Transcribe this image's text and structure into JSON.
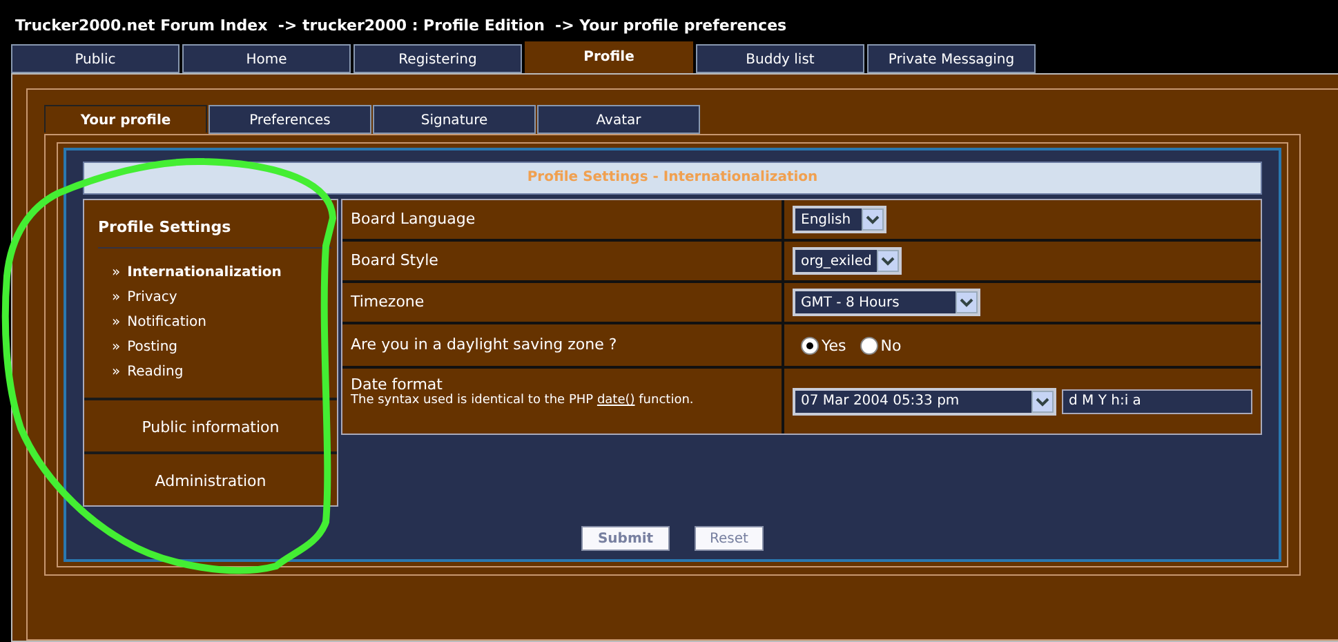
{
  "breadcrumb": "Trucker2000.net Forum Index  -> trucker2000 : Profile Edition  -> Your profile preferences",
  "top_tabs": [
    {
      "label": "Public",
      "selected": false
    },
    {
      "label": "Home",
      "selected": false
    },
    {
      "label": "Registering",
      "selected": false
    },
    {
      "label": "Profile",
      "selected": true
    },
    {
      "label": "Buddy list",
      "selected": false
    },
    {
      "label": "Private Messaging",
      "selected": false
    }
  ],
  "sub_tabs": [
    {
      "label": "Your profile",
      "selected": true
    },
    {
      "label": "Preferences",
      "selected": false
    },
    {
      "label": "Signature",
      "selected": false
    },
    {
      "label": "Avatar",
      "selected": false
    }
  ],
  "panel_title": "Profile Settings - Internationalization",
  "sidebar": {
    "heading": "Profile Settings",
    "marker": "»",
    "items": [
      {
        "label": "Internationalization",
        "selected": true
      },
      {
        "label": "Privacy",
        "selected": false
      },
      {
        "label": "Notification",
        "selected": false
      },
      {
        "label": "Posting",
        "selected": false
      },
      {
        "label": "Reading",
        "selected": false
      }
    ],
    "sections": [
      "Public information",
      "Administration"
    ]
  },
  "rows": [
    {
      "kind": "select",
      "label": "Board Language",
      "value": "English"
    },
    {
      "kind": "select",
      "label": "Board Style",
      "value": "org_exiled"
    },
    {
      "kind": "select",
      "label": "Timezone",
      "value": "GMT - 8 Hours"
    },
    {
      "kind": "radio",
      "label": "Are you in a daylight saving zone ?",
      "options": [
        {
          "label": "Yes",
          "selected": true
        },
        {
          "label": "No",
          "selected": false
        }
      ]
    },
    {
      "kind": "date",
      "label": "Date format",
      "explain": "The syntax used is identical to the PHP",
      "link": "date()",
      "explain_end": "function.",
      "value": "07 Mar 2004 05:33 pm",
      "input": "d M Y h:i a"
    }
  ],
  "buttons": [
    {
      "label": "Submit",
      "kind": "primary"
    },
    {
      "label": "Reset",
      "kind": "secondary"
    }
  ]
}
